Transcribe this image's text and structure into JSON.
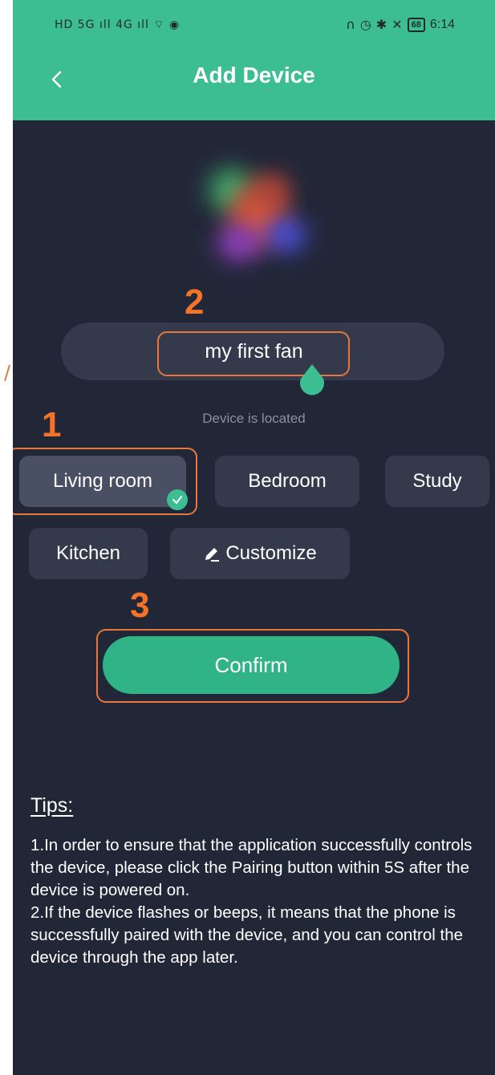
{
  "status_bar": {
    "left_indicators": "HD 5G ıll 4G ıll ⌔ ◉",
    "right_icons": [
      "headphones-icon",
      "alarm-icon",
      "bluetooth-icon",
      "mute-icon"
    ],
    "battery": "68",
    "time": "6:14"
  },
  "header": {
    "title": "Add Device",
    "back_icon": "chevron-left-icon",
    "color": "#3dbe92"
  },
  "device": {
    "name": "my first fan",
    "location_label": "Device is located"
  },
  "rooms": [
    {
      "label": "Living room",
      "selected": true
    },
    {
      "label": "Bedroom",
      "selected": false
    },
    {
      "label": "Study",
      "selected": false
    },
    {
      "label": "Kitchen",
      "selected": false
    },
    {
      "label": "Customize",
      "selected": false,
      "icon": "pencil-icon"
    }
  ],
  "confirm_label": "Confirm",
  "annotations": [
    "1",
    "2",
    "3"
  ],
  "tips": {
    "title": "Tips:",
    "lines": [
      "1.In order to ensure that the application successfully controls the device, please click the Pairing button within 5S after the device is powered on.",
      "2.If the device flashes or beeps, it means that the phone is successfully paired with the device, and you can control the device through the app later."
    ]
  },
  "colors": {
    "background": "#222738",
    "accent": "#3dbe92",
    "annotation": "#f37329",
    "chip": "#343a4c"
  }
}
